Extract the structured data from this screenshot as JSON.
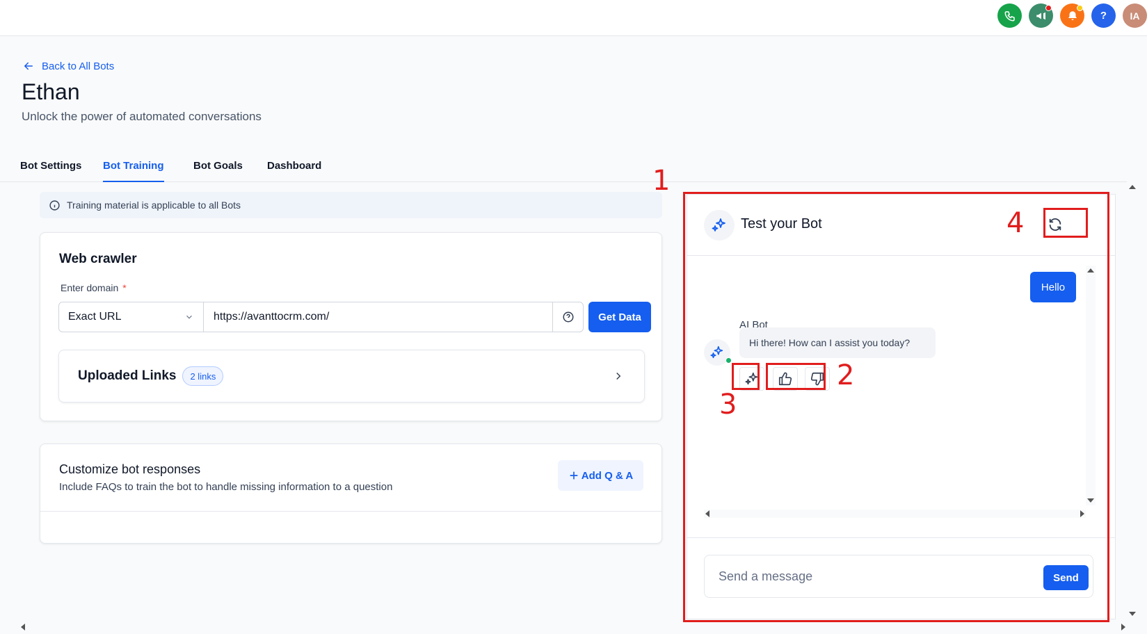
{
  "header": {
    "icons": [
      {
        "name": "phone-icon",
        "color": "#16a34a"
      },
      {
        "name": "megaphone-icon",
        "color": "#3b8d6b",
        "badge": "#e11d1d"
      },
      {
        "name": "bell-icon",
        "color": "#f97316",
        "badge": "#facc15"
      },
      {
        "name": "help-icon",
        "color": "#2563eb",
        "glyph": "?"
      },
      {
        "name": "avatar",
        "color": "#c98c77",
        "initials": "IA"
      }
    ]
  },
  "page": {
    "back_label": "Back to All Bots",
    "title": "Ethan",
    "subtitle": "Unlock the power of automated conversations"
  },
  "tabs": [
    {
      "label": "Bot Settings",
      "active": false
    },
    {
      "label": "Bot Training",
      "active": true
    },
    {
      "label": "Bot Goals",
      "active": false
    },
    {
      "label": "Dashboard",
      "active": false
    }
  ],
  "banner": {
    "text": "Training material is applicable to all Bots"
  },
  "crawler": {
    "title": "Web crawler",
    "domain_label": "Enter domain",
    "required_mark": "*",
    "match_type": "Exact URL",
    "url_value": "https://avanttocrm.com/",
    "get_data_label": "Get Data",
    "uploaded_title": "Uploaded Links",
    "uploaded_count": "2 links"
  },
  "custom": {
    "title": "Customize bot responses",
    "description": "Include FAQs to train the bot to handle missing information to a question",
    "add_label": "Add Q & A"
  },
  "test_panel": {
    "title": "Test your Bot",
    "messages": {
      "user_text": "Hello",
      "bot_name": "AI Bot",
      "bot_text": "Hi there! How can I assist you today?"
    },
    "input_placeholder": "Send a message",
    "send_label": "Send"
  },
  "annotations": [
    "1",
    "2",
    "3",
    "4"
  ],
  "colors": {
    "primary": "#155eef",
    "annotation": "#e11d1d",
    "online": "#17b26a"
  }
}
